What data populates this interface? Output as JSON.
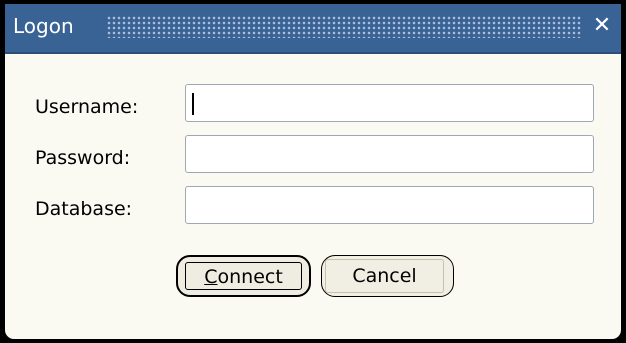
{
  "window": {
    "title": "Logon",
    "close_glyph": "✕"
  },
  "form": {
    "username_label": "Username:",
    "username_value": "",
    "password_label": "Password:",
    "password_value": "",
    "database_label": "Database:",
    "database_value": ""
  },
  "buttons": {
    "connect_mnemonic": "C",
    "connect_rest": "onnect",
    "cancel_label": "Cancel"
  },
  "colors": {
    "titlebar": "#3a6395",
    "dialog_background": "#faf9f2",
    "field_border": "#9fa7b3"
  }
}
